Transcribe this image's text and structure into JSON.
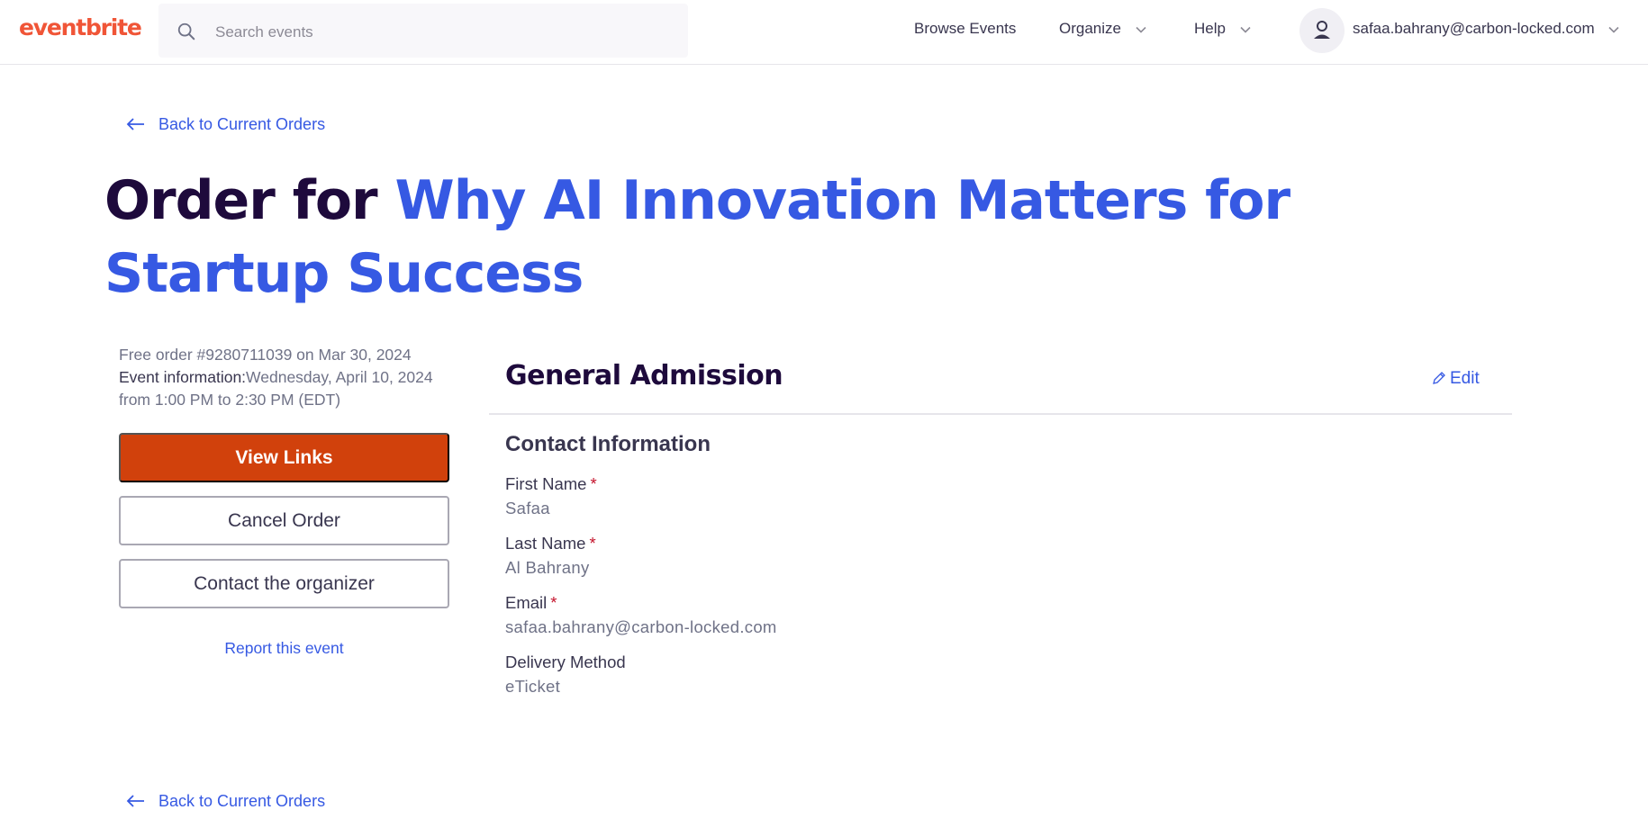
{
  "header": {
    "logo_text": "eventbrite",
    "search_placeholder": "Search events",
    "nav": {
      "browse": "Browse Events",
      "organize": "Organize",
      "help": "Help"
    },
    "user_email": "safaa.bahrany@carbon-locked.com"
  },
  "back_link_label": "Back to Current Orders",
  "title": {
    "prefix": "Order for ",
    "event_name": "Why AI Innovation Matters for Startup Success"
  },
  "order_meta": {
    "order_line": "Free order #9280711039 on Mar 30, 2024",
    "event_info_label": "Event information:",
    "event_info_value": "Wednesday, April 10, 2024 from 1:00 PM to 2:30 PM (EDT)"
  },
  "actions": {
    "view_links": "View Links",
    "cancel_order": "Cancel Order",
    "contact_organizer": "Contact the organizer",
    "report_event": "Report this event"
  },
  "ticket": {
    "name": "General Admission",
    "edit_label": "Edit",
    "section_title": "Contact Information",
    "fields": [
      {
        "label": "First Name",
        "required": true,
        "value": "Safaa"
      },
      {
        "label": "Last Name",
        "required": true,
        "value": "Al Bahrany"
      },
      {
        "label": "Email",
        "required": true,
        "value": "safaa.bahrany@carbon-locked.com"
      },
      {
        "label": "Delivery Method",
        "required": false,
        "value": "eTicket"
      }
    ],
    "required_marker": "*"
  },
  "colors": {
    "brand": "#f05537",
    "primary_button": "#d1410c",
    "link": "#3659e3",
    "heading": "#1e0a3c",
    "required": "#c5162e"
  }
}
